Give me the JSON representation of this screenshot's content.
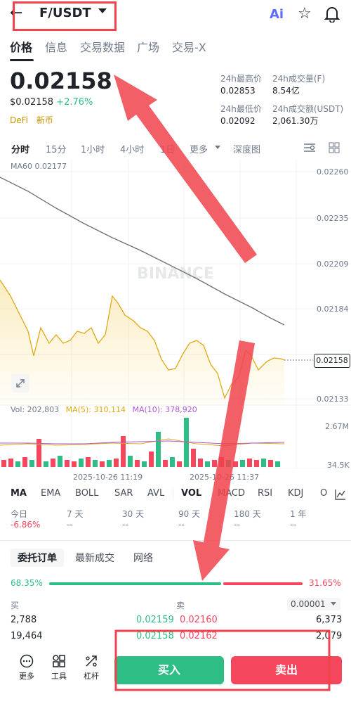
{
  "header": {
    "back_icon": "←",
    "pair": "F/USDT",
    "ai_label": "Ai"
  },
  "tabs": [
    "价格",
    "信息",
    "交易数据",
    "广场",
    "交易-X"
  ],
  "ticker": {
    "last": "0.02158",
    "usd": "$0.02158",
    "change": "+2.76%",
    "tags": [
      "DeFi",
      "新币"
    ]
  },
  "stats": {
    "high_label": "24h最高价",
    "high": "0.02853",
    "low_label": "24h最低价",
    "low": "0.02092",
    "vol_f_label": "24h成交量(F)",
    "vol_f": "8.54亿",
    "vol_usdt_label": "24h成交额(USDT)",
    "vol_usdt": "2,061.30万"
  },
  "intervals": [
    "分时",
    "15分",
    "1小时",
    "4小时",
    "1日",
    "更多",
    "深度图"
  ],
  "chart": {
    "ma60_label": "MA60 0.02177",
    "watermark": "BINANCE",
    "price_labels": [
      "0.02260",
      "0.02235",
      "0.02209",
      "0.02184",
      "0.02158",
      "0.02133"
    ],
    "current_price": "0.02158",
    "vol_label": "Vol: 202,803",
    "ma5_label": "MA(5): 310,114",
    "ma10_label": "MA(10): 378,920",
    "vol_axis": [
      "2.67M",
      "34.5K"
    ],
    "time_labels": [
      "2025-10-26 11:19",
      "2025-10-26 11:37"
    ]
  },
  "indicators": [
    "MA",
    "EMA",
    "BOLL",
    "SAR",
    "AVL",
    "VOL",
    "MACD",
    "RSI",
    "KDJ",
    "O"
  ],
  "performance": [
    {
      "label": "今日",
      "value": "-6.86%"
    },
    {
      "label": "7 天",
      "value": "--"
    },
    {
      "label": "30 天",
      "value": "--"
    },
    {
      "label": "90 天",
      "value": "--"
    },
    {
      "label": "180 天",
      "value": "--"
    },
    {
      "label": "1 年",
      "value": "--"
    }
  ],
  "orderbook": {
    "tabs": [
      "委托订单",
      "最新成交",
      "网络"
    ],
    "buy_pct": "68.35%",
    "sell_pct": "31.65%",
    "buy_label": "买",
    "sell_label": "卖",
    "precision": "0.00001",
    "rows": [
      {
        "bid_qty": "2,788",
        "bid": "0.02159",
        "ask": "0.02160",
        "ask_qty": "6,373"
      },
      {
        "bid_qty": "19,464",
        "bid": "0.02158",
        "ask": "0.02162",
        "ask_qty": "2,079"
      }
    ]
  },
  "bottom": {
    "more": "更多",
    "tools": "工具",
    "leverage": "杠杆",
    "buy": "买入",
    "sell": "卖出"
  },
  "colors": {
    "up": "#2ebd85",
    "down": "#f6465d",
    "accent": "#f0b90b",
    "annotation": "#f0434c"
  }
}
